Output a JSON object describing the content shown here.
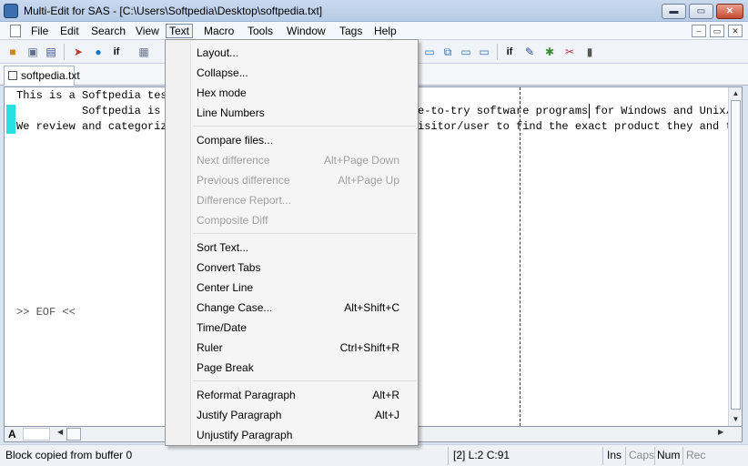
{
  "window": {
    "title": "Multi-Edit for SAS - [C:\\Users\\Softpedia\\Desktop\\softpedia.txt]",
    "min_glyph": "▬",
    "max_glyph": "▭",
    "close_glyph": "✕"
  },
  "menubar": {
    "items": [
      "File",
      "Edit",
      "Search",
      "View",
      "Text",
      "Macro",
      "Tools",
      "Window",
      "Tags",
      "Help"
    ],
    "active": "Text",
    "mdi_buttons": [
      "–",
      "▭",
      "✕"
    ]
  },
  "toolbar": {
    "icons": [
      "open-folder-icon",
      "save-icon",
      "save-all-icon",
      "run-icon",
      "globe-icon",
      "if-icon",
      "compile-icon",
      "window-icon",
      "tile-icon",
      "cascade-icon",
      "panel-icon",
      "if-check-icon",
      "search-abc-icon",
      "tool-icon",
      "bookmark-icon",
      "block-icon"
    ],
    "if_label": "if"
  },
  "tab": {
    "label": "softpedia.txt"
  },
  "editor": {
    "lines": [
      "This is a Softpedia test",
      "          Softpedia is",
      "We review and categoriz"
    ],
    "right_lines": [
      "e-to-try software programs for Windows and Unix/L",
      "isitor/user to find the exact product they and th"
    ],
    "eof_marker": ">> EOF <<"
  },
  "hbar": {
    "mode": "A"
  },
  "statusbar": {
    "message": "Block copied from buffer 0",
    "position": "[2] L:2 C:91",
    "flags": [
      {
        "label": "Ins",
        "active": true
      },
      {
        "label": "Caps",
        "active": false
      },
      {
        "label": "Num",
        "active": true
      },
      {
        "label": "Rec",
        "active": false
      }
    ]
  },
  "text_menu": {
    "items": [
      {
        "label": "Layout...",
        "shortcut": "",
        "enabled": true
      },
      {
        "label": "Collapse...",
        "shortcut": "",
        "enabled": true
      },
      {
        "label": "Hex mode",
        "shortcut": "",
        "enabled": true
      },
      {
        "label": "Line Numbers",
        "shortcut": "",
        "enabled": true
      },
      {
        "label": "Compare files...",
        "shortcut": "",
        "enabled": true
      },
      {
        "label": "Next difference",
        "shortcut": "Alt+Page Down",
        "enabled": false
      },
      {
        "label": "Previous difference",
        "shortcut": "Alt+Page Up",
        "enabled": false
      },
      {
        "label": "Difference Report...",
        "shortcut": "",
        "enabled": false
      },
      {
        "label": "Composite Diff",
        "shortcut": "",
        "enabled": false
      },
      {
        "label": "Sort Text...",
        "shortcut": "",
        "enabled": true
      },
      {
        "label": "Convert Tabs",
        "shortcut": "",
        "enabled": true
      },
      {
        "label": "Center Line",
        "shortcut": "",
        "enabled": true
      },
      {
        "label": "Change Case...",
        "shortcut": "Alt+Shift+C",
        "enabled": true
      },
      {
        "label": "Time/Date",
        "shortcut": "",
        "enabled": true
      },
      {
        "label": "Ruler",
        "shortcut": "Ctrl+Shift+R",
        "enabled": true
      },
      {
        "label": "Page Break",
        "shortcut": "",
        "enabled": true
      },
      {
        "label": "Reformat Paragraph",
        "shortcut": "Alt+R",
        "enabled": true
      },
      {
        "label": "Justify Paragraph",
        "shortcut": "Alt+J",
        "enabled": true
      },
      {
        "label": "Unjustify Paragraph",
        "shortcut": "",
        "enabled": true
      }
    ]
  }
}
